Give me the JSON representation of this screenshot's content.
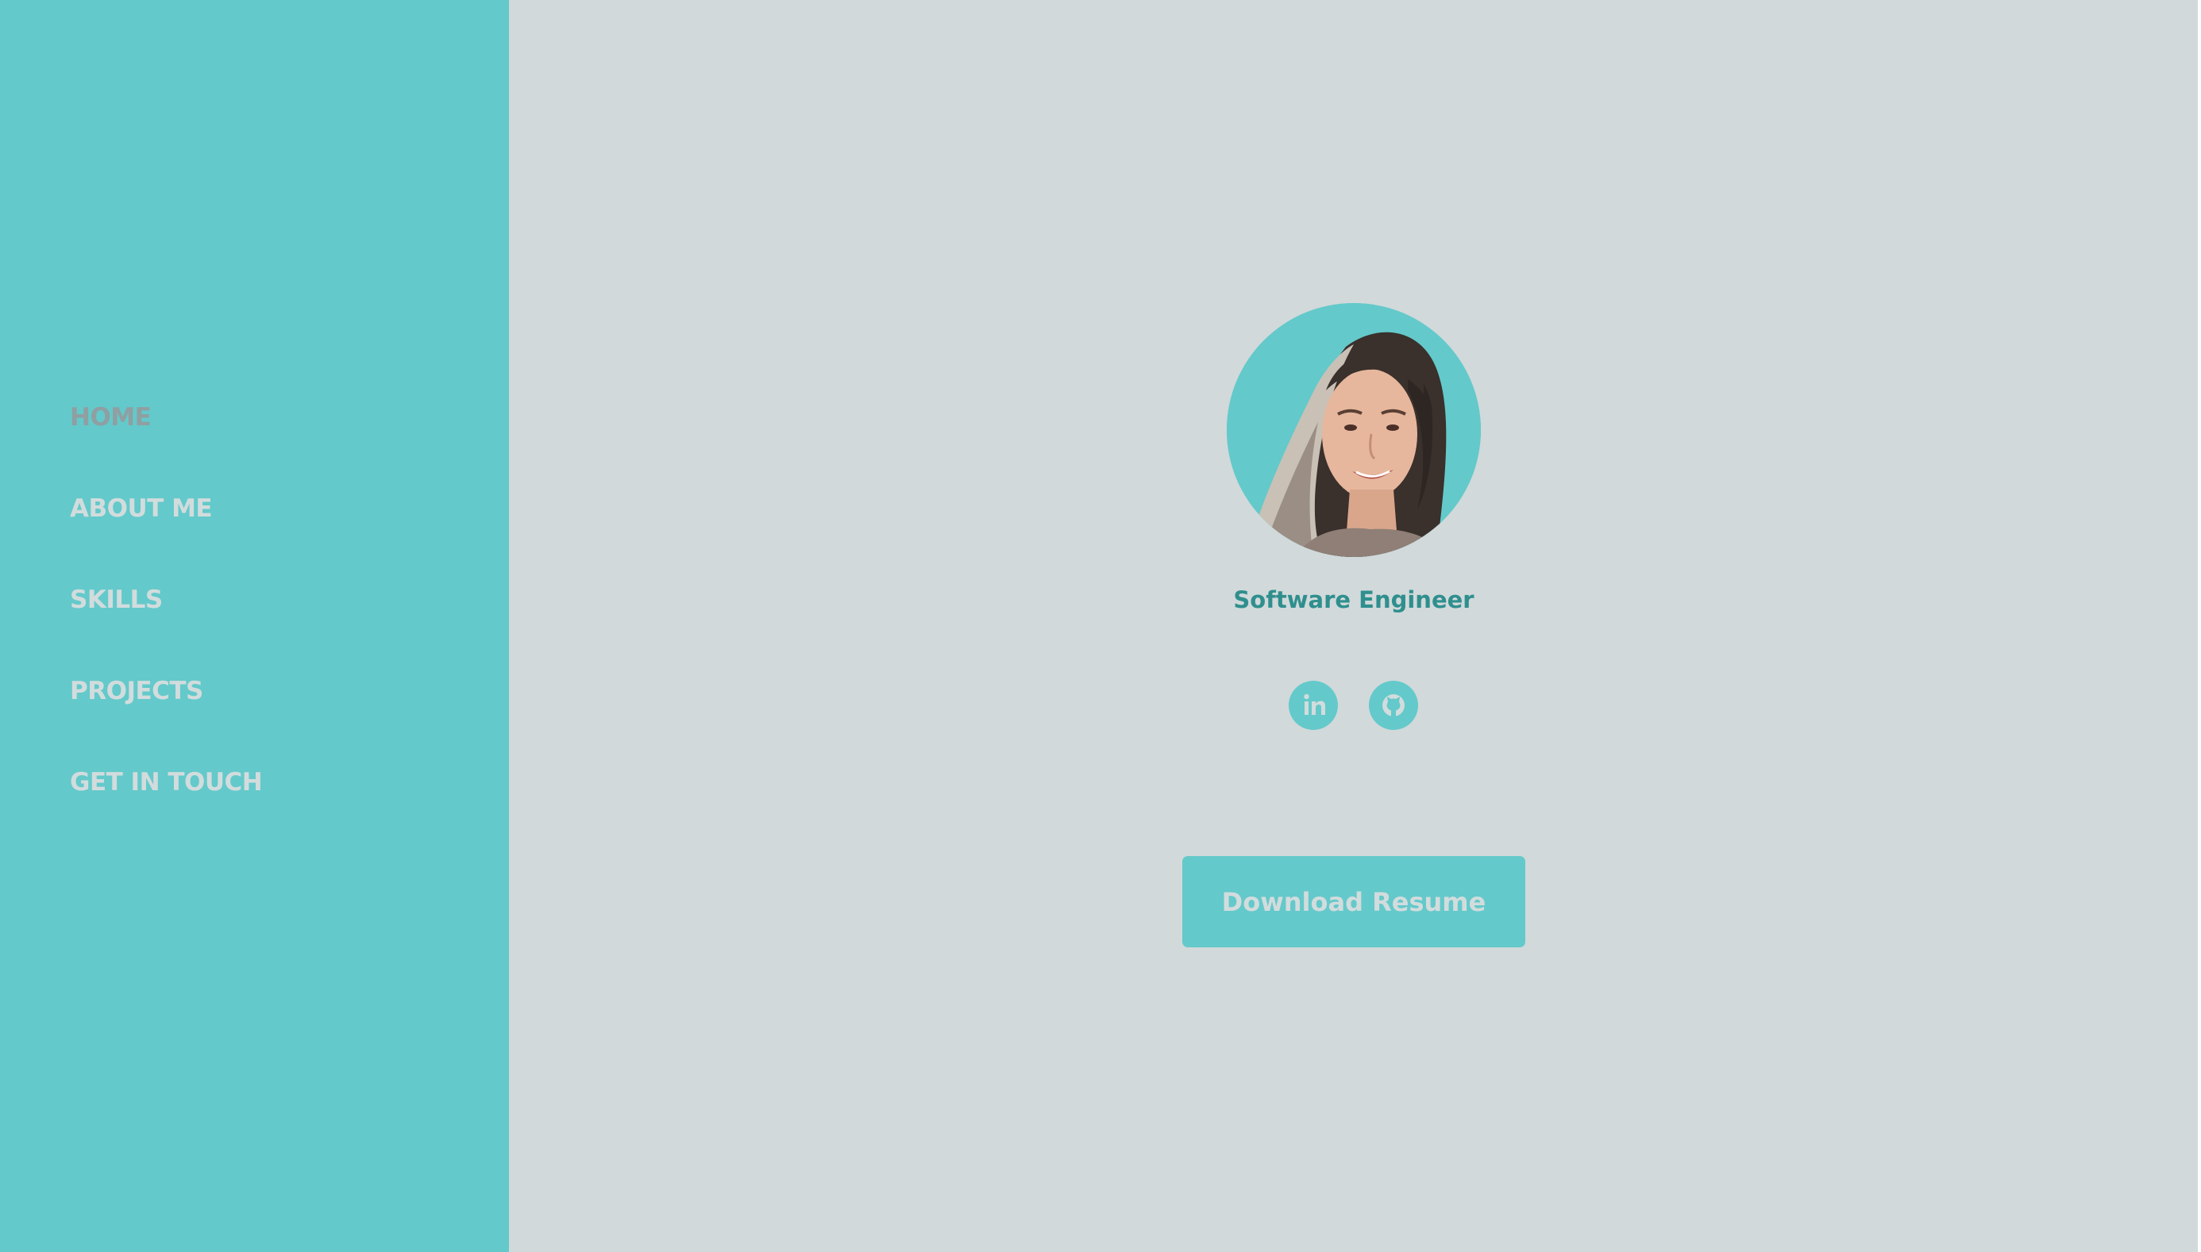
{
  "sidebar": {
    "nav": [
      {
        "label": "HOME",
        "active": true
      },
      {
        "label": "ABOUT ME",
        "active": false
      },
      {
        "label": "SKILLS",
        "active": false
      },
      {
        "label": "PROJECTS",
        "active": false
      },
      {
        "label": "GET IN TOUCH",
        "active": false
      }
    ]
  },
  "hero": {
    "role": "Software Engineer",
    "resume_button": "Download Resume",
    "social": [
      {
        "name": "linkedin-icon"
      },
      {
        "name": "github-icon"
      }
    ]
  },
  "colors": {
    "accent": "#64c9ca",
    "main_background": "#d1d9da",
    "role_text": "#2f8f8e",
    "nav_text": "#d2dcdd",
    "nav_active_text": "#8f9fa2"
  }
}
